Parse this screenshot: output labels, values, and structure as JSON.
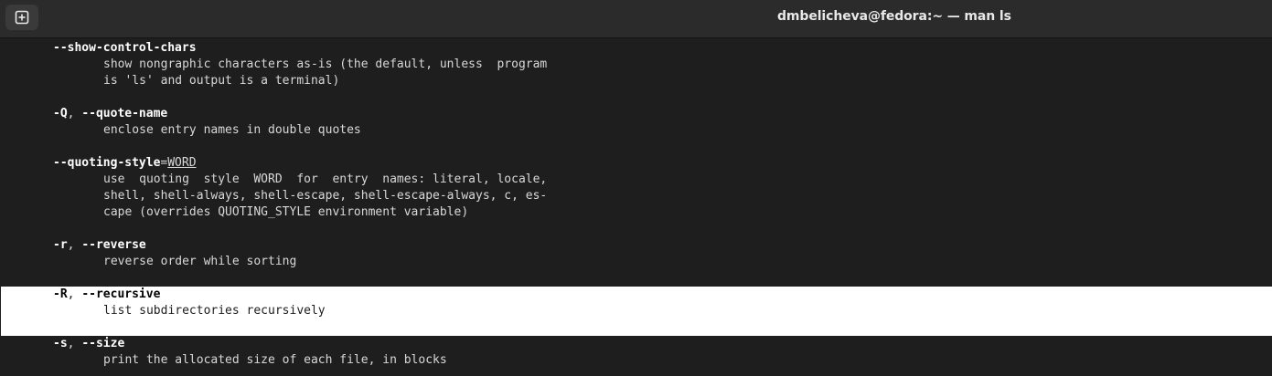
{
  "window": {
    "title": "dmbelicheva@fedora:~ — man ls"
  },
  "icons": {
    "new_tab": "new-tab-plus-icon"
  },
  "man": {
    "show_control_chars": {
      "flag": "--show-control-chars",
      "desc1": "show nongraphic characters as-is (the default, unless  program",
      "desc2": "is 'ls' and output is a terminal)"
    },
    "quote_name": {
      "short": "-Q",
      "sep": ", ",
      "long": "--quote-name",
      "desc1": "enclose entry names in double quotes"
    },
    "quoting_style": {
      "flag": "--quoting-style",
      "eq": "=",
      "arg": "WORD",
      "desc1": "use  quoting  style  WORD  for  entry  names: literal, locale,",
      "desc2": "shell, shell-always, shell-escape, shell-escape-always, c, es‐",
      "desc3": "cape (overrides QUOTING_STYLE environment variable)"
    },
    "reverse": {
      "short": "-r",
      "sep": ", ",
      "long": "--reverse",
      "desc1": "reverse order while sorting"
    },
    "recursive": {
      "short": "-R",
      "sep": ", ",
      "long": "--recursive",
      "desc1": "list subdirectories recursively"
    },
    "size": {
      "short": "-s",
      "sep": ", ",
      "long": "--size",
      "desc1": "print the allocated size of each file, in blocks"
    }
  }
}
